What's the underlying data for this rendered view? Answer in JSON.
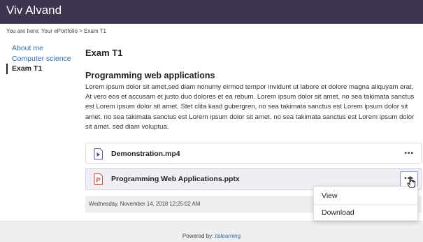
{
  "header": {
    "site_title": "Viv Alvand",
    "background": "#3d3450"
  },
  "breadcrumb": {
    "text": "You are here: Your ePortfolio > Exam T1"
  },
  "sidebar": {
    "items": [
      {
        "label": "About me",
        "active": false
      },
      {
        "label": "Computer science",
        "active": false
      },
      {
        "label": "Exam T1",
        "active": true
      }
    ]
  },
  "main": {
    "page_title": "Exam T1",
    "section_title": "Programming web applications",
    "body": "Lorem ipsum dolor sit amet,sed diam nonumy eirmod tempor invidunt ut labore et dolore magna aliquyam erat,  At vero eos et accusam et justo duo dolores et ea rebum.  Lorem ipsum dolor sit amet,  no sea takimata sanctus est Lorem ipsum dolor sit amet.  Stet clita kasd gubergren,  no sea takimata sanctus est Lorem ipsum dolor sit amet.  no sea takimata sanctus est Lorem ipsum dolor sit amet.  no sea takimata sanctus est Lorem ipsum dolor sit amet.  sed diam voluptua."
  },
  "files": [
    {
      "name": "Demonstration.mp4",
      "icon": "video-file-icon",
      "more": "•••",
      "icon_color": "#6a4f8f"
    },
    {
      "name": "Programming Web Applications.pptx",
      "icon": "powerpoint-file-icon",
      "more": "•••",
      "icon_color": "#d0492c"
    }
  ],
  "timestamp": "Wednesday, November 14, 2018 12:25:02 AM",
  "context_menu": {
    "items": [
      "View",
      "Download"
    ]
  },
  "footer": {
    "powered_by": "Powered by: ",
    "brand": "itslearning",
    "brand_color": "#2a6db8"
  }
}
